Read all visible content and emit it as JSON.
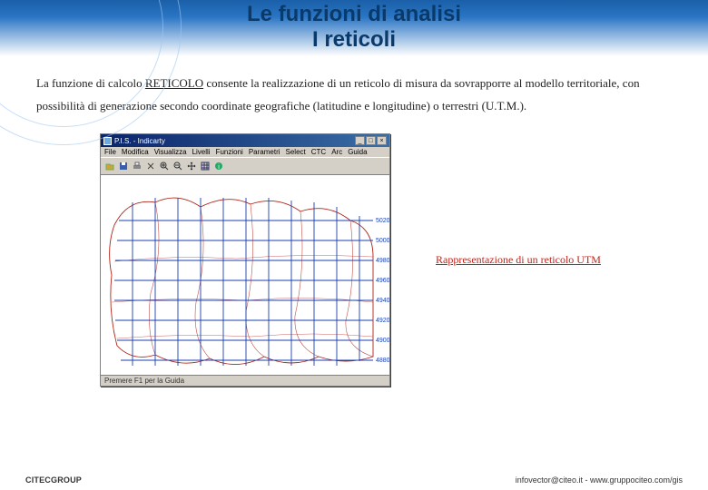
{
  "header": {
    "title_line1": "Le funzioni di analisi",
    "title_line2": "I reticoli"
  },
  "body": {
    "p1_a": "La funzione di calcolo ",
    "p1_kw": "RETICOLO",
    "p1_b": " consente la realizzazione di un reticolo di misura da sovrapporre al modello territoriale, con possibilità di generazione secondo coordinate geografiche (latitudine e longitudine) o terrestri (U.T.M.)."
  },
  "app": {
    "title": "P.I.S. - Indicarty",
    "menu": [
      "File",
      "Modifica",
      "Visualizza",
      "Livelli",
      "Funzioni",
      "Parametri",
      "Select",
      "CTC",
      "Arc",
      "Guida"
    ],
    "statusbar": "Premere F1 per la Guida",
    "window_controls": {
      "min": "_",
      "max": "□",
      "close": "×"
    },
    "y_labels": [
      "5020",
      "5000",
      "4980",
      "4960",
      "4940",
      "4920",
      "4900",
      "4880"
    ]
  },
  "toolbar_icons": [
    "open-icon",
    "save-icon",
    "print-icon",
    "cut-icon",
    "zoom-in-icon",
    "zoom-out-icon",
    "pan-icon",
    "grid-icon",
    "info-icon"
  ],
  "caption": "Rappresentazione di un reticolo UTM",
  "footer": {
    "left": "CITECGROUP",
    "right": "infovector@citeo.it - www.gruppociteo.com/gis"
  }
}
